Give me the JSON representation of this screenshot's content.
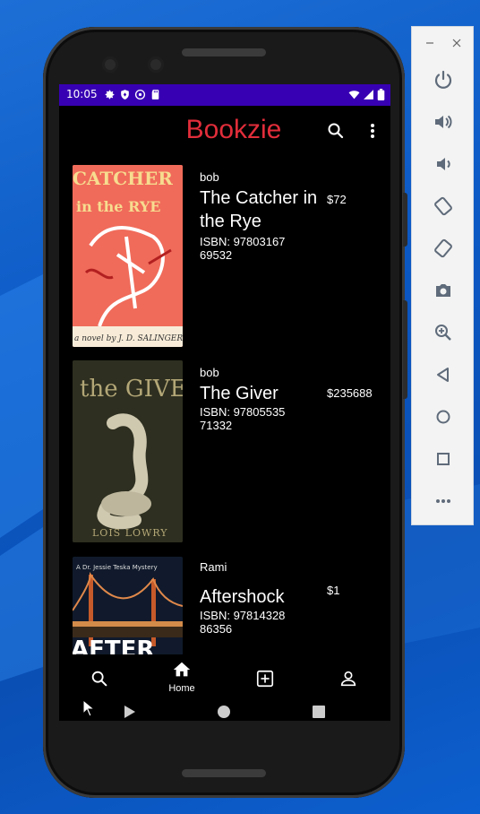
{
  "status_bar": {
    "time": "10:05"
  },
  "app": {
    "title": "Bookzie"
  },
  "books": [
    {
      "seller": "bob",
      "title": "The Catcher in the Rye",
      "isbn": "ISBN: 9780316769532",
      "price": "$72",
      "cover_text_top": "CATCHER",
      "cover_text_mid": "in the RYE",
      "cover_text_bottom": "a novel by J. D. SALINGER"
    },
    {
      "seller": "bob",
      "title": "The Giver",
      "isbn": "ISBN: 9780553571332",
      "price": "$235688",
      "cover_text_top": "the GIVER",
      "cover_text_bottom": "LOIS LOWRY"
    },
    {
      "seller": "Rami",
      "title": "Aftershock",
      "isbn": "ISBN: 9781432886356",
      "price": "$1",
      "cover_text_top": "A Dr. Jessie Teska Mystery",
      "cover_text_bottom": "AFTER"
    }
  ],
  "bottom_nav": {
    "items": [
      {
        "icon": "search-icon",
        "label": ""
      },
      {
        "icon": "home-icon",
        "label": "Home"
      },
      {
        "icon": "add-box-icon",
        "label": ""
      },
      {
        "icon": "account-icon",
        "label": ""
      }
    ]
  },
  "emulator_toolbar": {
    "buttons": [
      "power-icon",
      "volume-up-icon",
      "volume-down-icon",
      "rotate-left-icon",
      "rotate-right-icon",
      "camera-icon",
      "zoom-icon",
      "back-icon",
      "home-circle-icon",
      "overview-icon",
      "more-icon"
    ]
  },
  "colors": {
    "accent": "#e12d3a",
    "status_bar": "#3700b3",
    "desktop": "#0b58c4"
  }
}
